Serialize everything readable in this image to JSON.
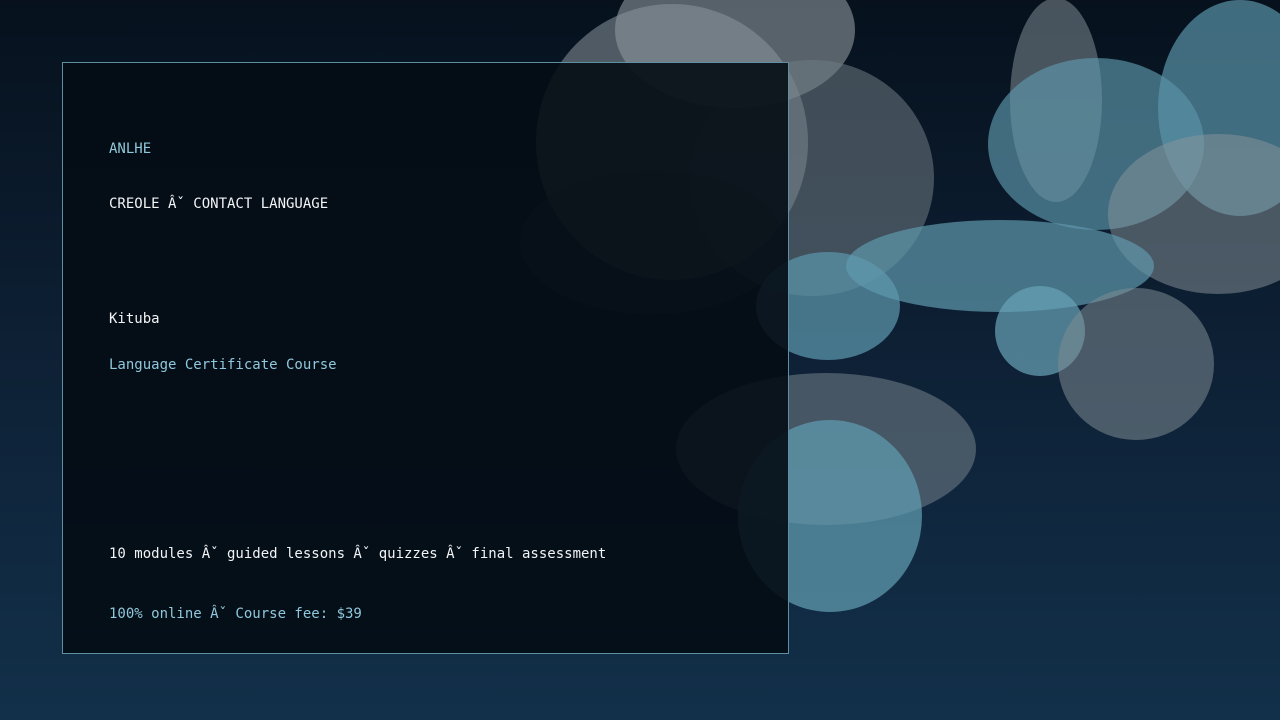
{
  "brand": "ANLHE",
  "category": "CREOLE Âˇ CONTACT LANGUAGE",
  "language_name": "Kituba",
  "course_title": "Language Certificate Course",
  "details_line": "10 modules Âˇ guided lessons Âˇ quizzes Âˇ final assessment",
  "pricing_line": "100% online Âˇ Course fee: $39",
  "colors": {
    "accent": "#8fc8dc",
    "text": "#f2f4f6",
    "card_border": "#5f8fa3",
    "bubble_teal": "#4a7e92",
    "bubble_grey": "#6a7880"
  }
}
